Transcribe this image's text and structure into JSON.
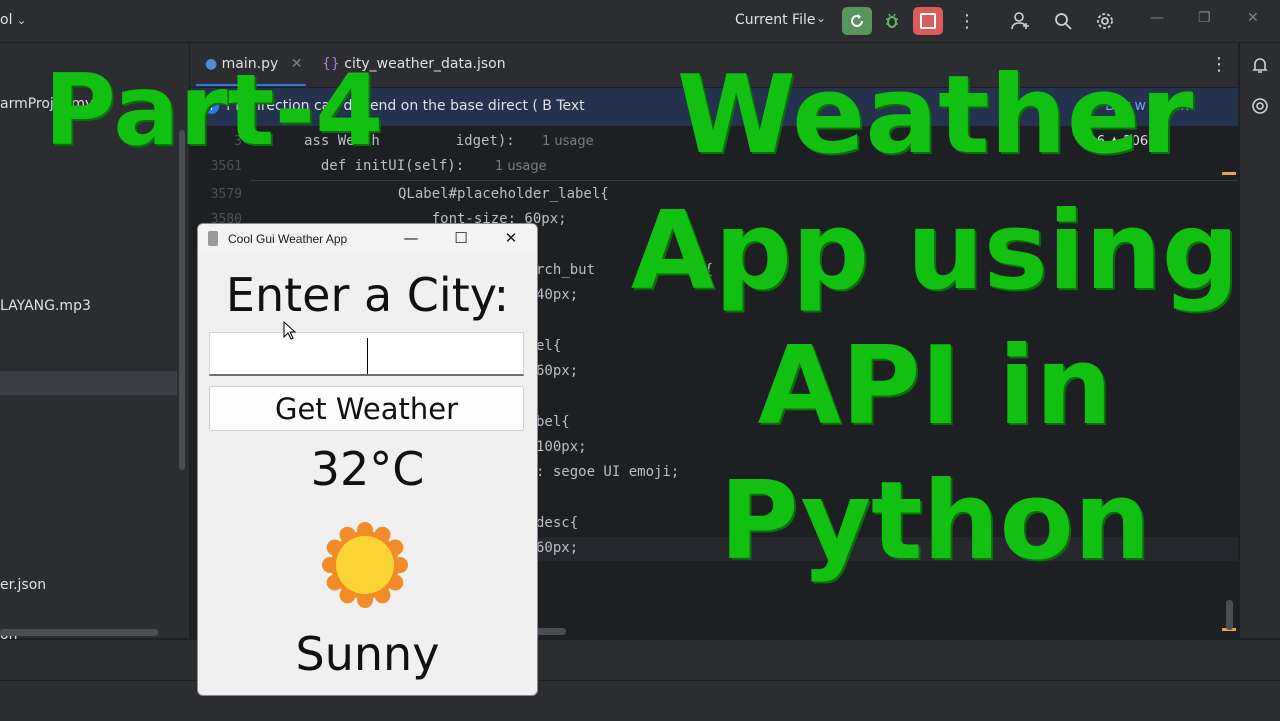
{
  "ide": {
    "project_fragment": "ol",
    "run_config": "Current File",
    "tabs": [
      {
        "label": "main.py"
      },
      {
        "label": "city_weather_data.json"
      }
    ],
    "banner_text": "f bidirection   can depend on the base direct   (   B     Text",
    "banner_action": "Dor   w again",
    "inspection": "⚠ 6   ▲ 206",
    "sidebar_items": [
      {
        "label": "armProje   .my    Pr"
      },
      {
        "label": "LAYANG.mp3"
      },
      {
        "label": "er.json"
      },
      {
        "label": "on"
      }
    ],
    "sticky_lines": [
      {
        "num": "3",
        "code": "ass Weath         idget):",
        "hint": "1 usage"
      },
      {
        "num": "3561",
        "code": "  def initUI(self):",
        "hint": "1 usage"
      }
    ],
    "code_lines": [
      {
        "num": "3579",
        "code": "QLabel#placeholder_label{"
      },
      {
        "num": "3580",
        "code": "    font-size: 60px;"
      },
      {
        "num": "",
        "code": "rch_but      ne   it{"
      },
      {
        "num": "",
        "code": "40px;"
      },
      {
        "num": "",
        "code": "el{"
      },
      {
        "num": "",
        "code": "60px;"
      },
      {
        "num": "",
        "code": "bel{"
      },
      {
        "num": "",
        "code": "100px;"
      },
      {
        "num": "",
        "code": ": segoe UI emoji;"
      },
      {
        "num": "",
        "code": "desc{"
      },
      {
        "num": "",
        "code": "60px;"
      }
    ]
  },
  "app": {
    "title": "Cool Gui Weather App",
    "city_label": "Enter a City:",
    "city_input_value": "",
    "button_label": "Get Weather",
    "temperature": "32°C",
    "emoji_icon": "sun-icon",
    "description": "Sunny"
  },
  "overlay": {
    "part": "Part-4",
    "lines": [
      "Weather",
      "App using",
      "API in",
      "Python"
    ]
  },
  "colors": {
    "overlay_green": "#12c012",
    "run_green": "#57965c",
    "stop_red": "#db5c5c",
    "banner_blue": "#25324d",
    "sun_orange": "#f28c28",
    "sun_yellow": "#fcd535"
  }
}
